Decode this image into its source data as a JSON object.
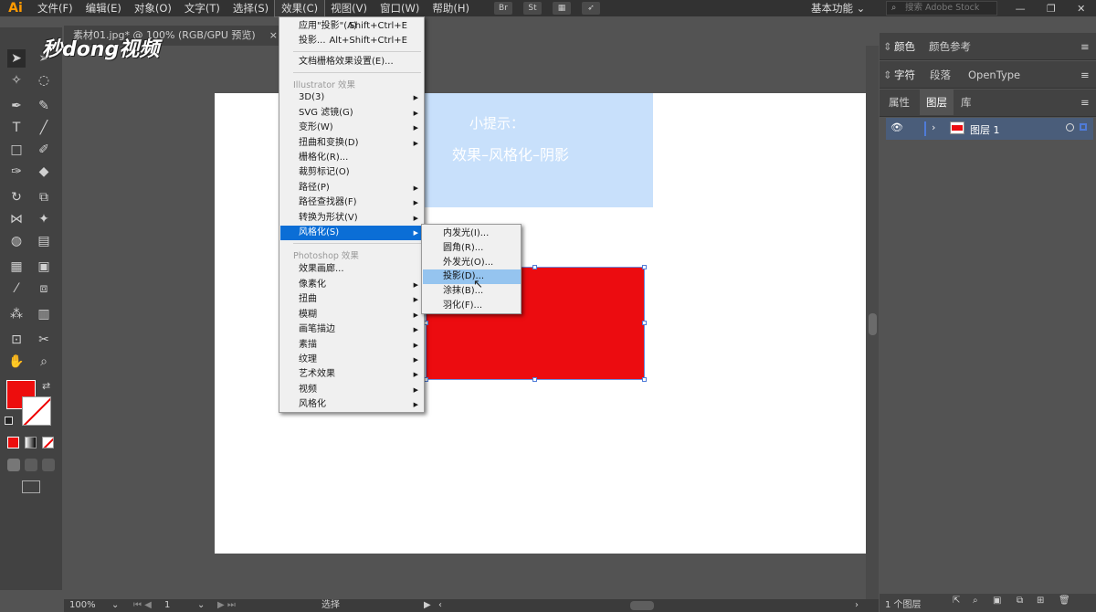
{
  "app": {
    "logo": "Ai",
    "workspace": "基本功能",
    "search_placeholder": "搜索 Adobe Stock"
  },
  "menubar": [
    "文件(F)",
    "编辑(E)",
    "对象(O)",
    "文字(T)",
    "选择(S)",
    "效果(C)",
    "视图(V)",
    "窗口(W)",
    "帮助(H)"
  ],
  "toolbar_icons": {
    "br": "Br",
    "st": "St"
  },
  "document": {
    "tab": "素材01.jpg* @ 100% (RGB/GPU 预览)",
    "close": "×"
  },
  "watermark": "秒dong视频",
  "canvas": {
    "tip_title": "小提示：",
    "tip_body": "效果–风格化–阴影"
  },
  "effect_menu": {
    "apply_last": {
      "label": "应用\"投影\"(A)",
      "shortcut": "Shift+Ctrl+E"
    },
    "last": {
      "label": "投影...",
      "shortcut": "Alt+Shift+Ctrl+E"
    },
    "raster_settings": "文档栅格效果设置(E)...",
    "illustrator_header": "Illustrator 效果",
    "illustrator_items": [
      "3D(3)",
      "SVG 滤镜(G)",
      "变形(W)",
      "扭曲和变换(D)",
      "栅格化(R)...",
      "裁剪标记(O)",
      "路径(P)",
      "路径查找器(F)",
      "转换为形状(V)",
      "风格化(S)"
    ],
    "photoshop_header": "Photoshop 效果",
    "photoshop_items": [
      "效果画廊...",
      "像素化",
      "扭曲",
      "模糊",
      "画笔描边",
      "素描",
      "纹理",
      "艺术效果",
      "视频",
      "风格化"
    ]
  },
  "stylize_submenu": [
    "内发光(I)...",
    "圆角(R)...",
    "外发光(O)...",
    "投影(D)...",
    "涂抹(B)...",
    "羽化(F)..."
  ],
  "panels": {
    "color": "颜色",
    "color_ref": "颜色参考",
    "char": "字符",
    "para": "段落",
    "opentype": "OpenType",
    "props": "属性",
    "layers": "图层",
    "libs": "库",
    "layer_name": "图层 1",
    "layer_count": "1 个图层"
  },
  "status": {
    "zoom": "100%",
    "artboard": "1",
    "tool": "选择"
  },
  "colors": {
    "fill": "#ed0d0d",
    "highlight": "#0b6ed6",
    "tipbox": "#c8e0fb"
  }
}
